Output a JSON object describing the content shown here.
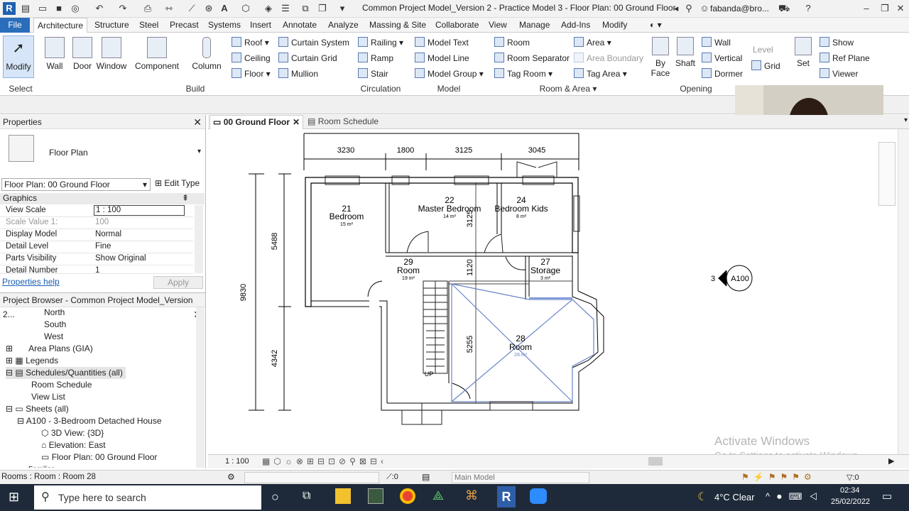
{
  "title_bar": {
    "app_letter": "R",
    "document_title": "Common Project Model_Version 2 - Practice Model 3 - Floor Plan: 00 Ground Floor",
    "user": "fabanda@bro..."
  },
  "ribbon_tabs": [
    "File",
    "Architecture",
    "Structure",
    "Steel",
    "Precast",
    "Systems",
    "Insert",
    "Annotate",
    "Analyze",
    "Massing & Site",
    "Collaborate",
    "View",
    "Manage",
    "Add-Ins",
    "Modify"
  ],
  "ribbon": {
    "select": {
      "modify": "Modify",
      "panel": "Select"
    },
    "build": {
      "wall": "Wall",
      "door": "Door",
      "window": "Window",
      "component": "Component",
      "column": "Column",
      "roof": "Roof",
      "ceiling": "Ceiling",
      "floor": "Floor",
      "curtain_system": "Curtain System",
      "curtain_grid": "Curtain Grid",
      "mullion": "Mullion",
      "panel": "Build"
    },
    "circulation": {
      "railing": "Railing",
      "ramp": "Ramp",
      "stair": "Stair",
      "panel": "Circulation"
    },
    "model": {
      "model_text": "Model Text",
      "model_line": "Model Line",
      "model_group": "Model Group",
      "panel": "Model"
    },
    "room_area": {
      "room": "Room",
      "room_separator": "Room Separator",
      "tag_room": "Tag Room",
      "area": "Area",
      "area_boundary": "Area Boundary",
      "tag_area": "Tag Area",
      "panel": "Room & Area"
    },
    "opening": {
      "by_face": "By Face",
      "shaft": "Shaft",
      "wall": "Wall",
      "vertical": "Vertical",
      "dormer": "Dormer",
      "panel": "Opening"
    },
    "datum": {
      "level": "Level",
      "grid": "Grid"
    },
    "work_plane": {
      "set": "Set",
      "show": "Show",
      "ref_plane": "Ref Plane",
      "viewer": "Viewer"
    }
  },
  "properties": {
    "title": "Properties",
    "type_name": "Floor Plan",
    "instance_selector": "Floor Plan: 00 Ground Floor",
    "edit_type": "Edit Type",
    "group": "Graphics",
    "rows": [
      {
        "key": "View Scale",
        "value": "1 : 100"
      },
      {
        "key": "Scale Value    1:",
        "value": "100"
      },
      {
        "key": "Display Model",
        "value": "Normal"
      },
      {
        "key": "Detail Level",
        "value": "Fine"
      },
      {
        "key": "Parts Visibility",
        "value": "Show Original"
      },
      {
        "key": "Detail Number",
        "value": "1"
      }
    ],
    "help_link": "Properties help",
    "apply": "Apply"
  },
  "browser": {
    "title": "Project Browser - Common Project Model_Version 2...",
    "items": [
      "North",
      "South",
      "West",
      "Area Plans (GIA)",
      "Legends",
      "Schedules/Quantities (all)",
      "Room Schedule",
      "View List",
      "Sheets (all)",
      "A100 - 3-Bedroom Detached House",
      "3D View: {3D}",
      "Elevation: East",
      "Floor Plan: 00 Ground Floor",
      "Families"
    ]
  },
  "view_tabs": {
    "active": "00 Ground Floor",
    "other": "Room Schedule"
  },
  "plan": {
    "dims_top": [
      "3230",
      "1800",
      "3125",
      "3045"
    ],
    "dims_left": [
      "5488",
      "9830",
      "4342"
    ],
    "dims_inner": [
      "3125",
      "1120",
      "5255"
    ],
    "rooms": [
      {
        "num": "21",
        "name": "Bedroom",
        "area": "15 m²"
      },
      {
        "num": "22",
        "name": "Master Bedroom",
        "area": "14 m²"
      },
      {
        "num": "24",
        "name": "Bedroom Kids",
        "area": "8 m²"
      },
      {
        "num": "29",
        "name": "Room",
        "area": "19 m²"
      },
      {
        "num": "27",
        "name": "Storage",
        "area": "3 m²"
      },
      {
        "num": "28",
        "name": "Room",
        "area": "28 m²"
      }
    ],
    "up_label": "UP",
    "elevation_num": "3",
    "elevation_sheet": "A100"
  },
  "view_control": {
    "scale": "1 : 100"
  },
  "status": {
    "selection": "Rooms : Room : Room 28",
    "count": ":0",
    "model": "Main Model",
    "filter": ":0"
  },
  "watermark": {
    "line1": "Activate Windows",
    "line2": "Go to Settings to activate Windows."
  },
  "taskbar": {
    "search": "Type here to search",
    "weather": "4°C  Clear",
    "time": "02:34",
    "date": "25/02/2022"
  }
}
